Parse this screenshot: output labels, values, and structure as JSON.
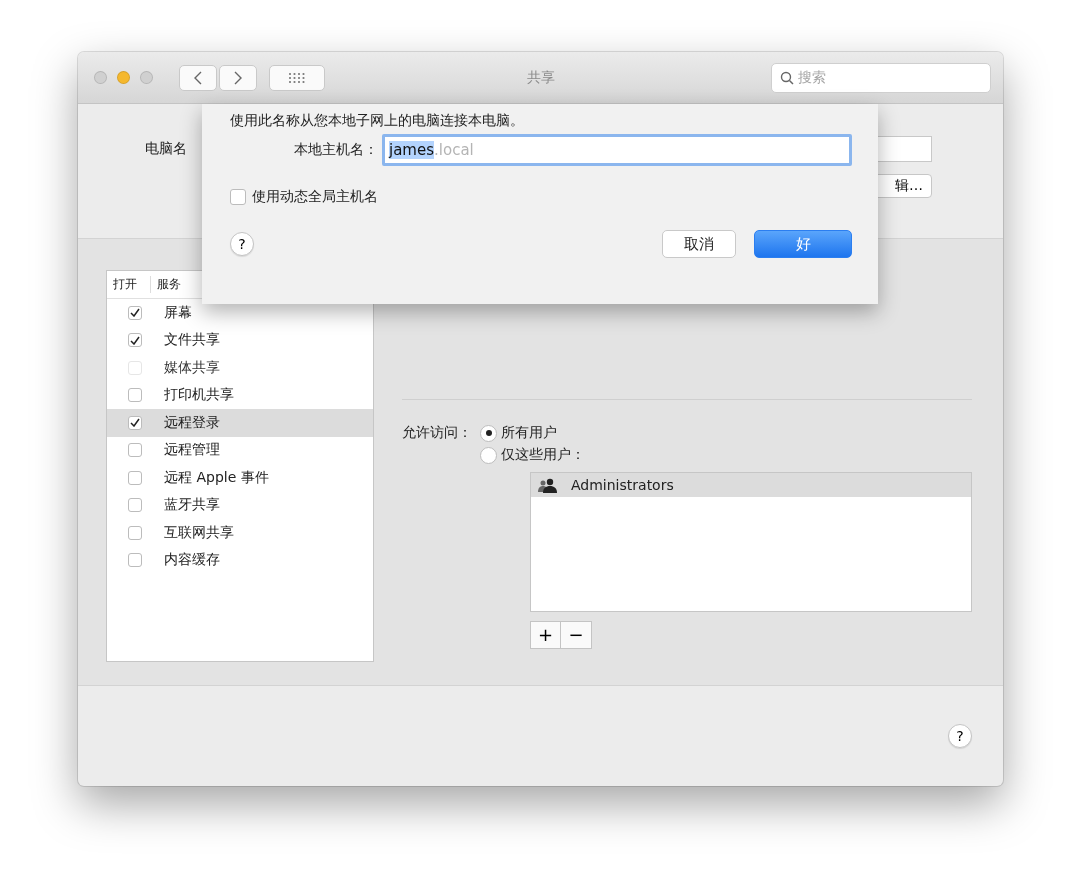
{
  "window": {
    "title": "共享"
  },
  "toolbar": {
    "search": {
      "placeholder": "搜索"
    }
  },
  "computer_name": {
    "label": "电脑名",
    "edit_button": "辑…"
  },
  "sheet": {
    "description": "使用此名称从您本地子网上的电脑连接本电脑。",
    "hostname_label": "本地主机名：",
    "hostname": {
      "value": "james",
      "suffix": ".local",
      "selected": true
    },
    "dynamic_checkbox": {
      "label": "使用动态全局主机名",
      "checked": false
    },
    "help": "?",
    "buttons": [
      {
        "label": "取消",
        "default": false
      },
      {
        "label": "好",
        "default": true
      }
    ]
  },
  "services": {
    "columns": [
      "打开",
      "服务"
    ],
    "rows": [
      {
        "name": "屏幕",
        "checked": true,
        "disabled": false,
        "selected": false
      },
      {
        "name": "文件共享",
        "checked": true,
        "disabled": false,
        "selected": false
      },
      {
        "name": "媒体共享",
        "checked": false,
        "disabled": true,
        "selected": false
      },
      {
        "name": "打印机共享",
        "checked": false,
        "disabled": false,
        "selected": false
      },
      {
        "name": "远程登录",
        "checked": true,
        "disabled": false,
        "selected": true
      },
      {
        "name": "远程管理",
        "checked": false,
        "disabled": false,
        "selected": false
      },
      {
        "name": "远程 Apple 事件",
        "checked": false,
        "disabled": false,
        "selected": false
      },
      {
        "name": "蓝牙共享",
        "checked": false,
        "disabled": false,
        "selected": false
      },
      {
        "name": "互联网共享",
        "checked": false,
        "disabled": false,
        "selected": false
      },
      {
        "name": "内容缓存",
        "checked": false,
        "disabled": false,
        "selected": false
      }
    ]
  },
  "access": {
    "label": "允许访问：",
    "options": [
      {
        "label": "所有用户",
        "selected": true
      },
      {
        "label": "仅这些用户：",
        "selected": false
      }
    ],
    "users": [
      {
        "name": "Administrators",
        "selected": true
      }
    ],
    "add": "+",
    "remove": "−"
  },
  "help": "?"
}
